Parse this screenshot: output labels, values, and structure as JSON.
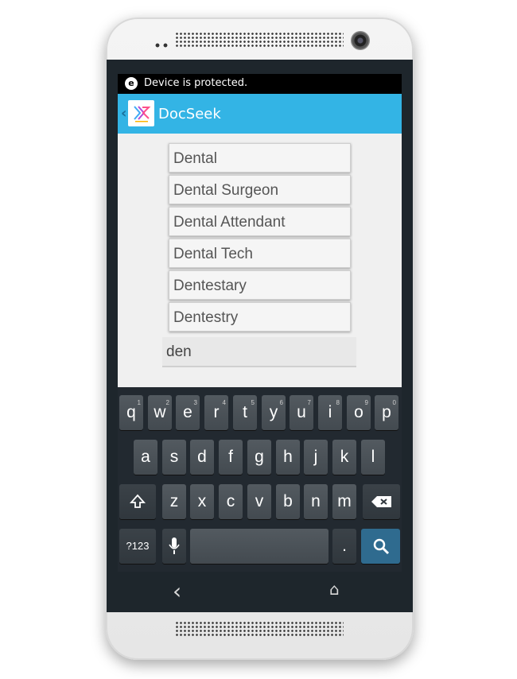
{
  "status_bar": {
    "icon": "e",
    "text": "Device is protected."
  },
  "action_bar": {
    "title": "DocSeek",
    "logo_icon": "docseek-logo-icon"
  },
  "suggestions": [
    "Dental",
    "Dental Surgeon",
    "Dental Attendant",
    "Dental Tech",
    "Dentestary",
    "Dentestry"
  ],
  "search": {
    "value": "den"
  },
  "keyboard": {
    "row1": [
      {
        "k": "q",
        "n": "1"
      },
      {
        "k": "w",
        "n": "2"
      },
      {
        "k": "e",
        "n": "3"
      },
      {
        "k": "r",
        "n": "4"
      },
      {
        "k": "t",
        "n": "5"
      },
      {
        "k": "y",
        "n": "6"
      },
      {
        "k": "u",
        "n": "7"
      },
      {
        "k": "i",
        "n": "8"
      },
      {
        "k": "o",
        "n": "9"
      },
      {
        "k": "p",
        "n": "0"
      }
    ],
    "row2": [
      "a",
      "s",
      "d",
      "f",
      "g",
      "h",
      "j",
      "k",
      "l"
    ],
    "row3": [
      "z",
      "x",
      "c",
      "v",
      "b",
      "n",
      "m"
    ],
    "symbols_label": "?123",
    "period_label": "."
  },
  "colors": {
    "action_bar": "#33b4e5",
    "keyboard": "#222930",
    "search_key": "#2f6b8f"
  }
}
